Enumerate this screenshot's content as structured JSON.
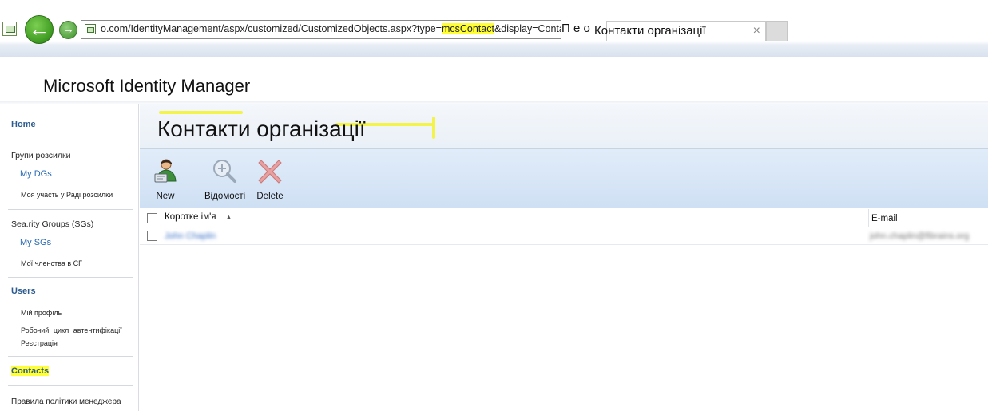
{
  "browser": {
    "url_pre": "o.com/IdentityManagement/aspx/customized/CustomizedObjects.aspx?type=",
    "url_highlight": "mcsContact",
    "url_post": "&display=Contact",
    "tab_prefix": "П е о",
    "tab_title": "Контакти організації",
    "tab_close_glyph": "×"
  },
  "header": {
    "app_title": "Microsoft Identity Manager"
  },
  "sidebar": {
    "home": "Home",
    "dist_group": "Групи розсилки",
    "my_dgs": "My DGs",
    "my_dg_membership": "Моя участь у Раді розсилки",
    "sec_group": "Sea.rity Groups (SGs)",
    "my_sgs": "My SGs",
    "my_sg_membership": "Мої членства в СГ",
    "users": "Users",
    "my_profile": "Мій профіль",
    "auth_workflow": "Робочий цикл автентифікації",
    "registration": "Реєстрація",
    "contacts": "Contacts",
    "policy_rules": "Правила політики менеджера"
  },
  "main": {
    "page_title": "Контакти організації",
    "toolbar": {
      "new_label": "New",
      "details_label": "Відомості",
      "delete_label": "Delete"
    },
    "grid": {
      "col_name": "Коротке ім'я",
      "col_email": "E-mail",
      "rows": [
        {
          "name": "John Chaplin",
          "email": "john.chaplin@fibrains.org"
        }
      ]
    }
  },
  "colors": {
    "highlight": "#ffff33",
    "nav_heading": "#2b5b8f",
    "nav_link": "#2769b4",
    "toolbar_bg": "#cfe0f4"
  },
  "icons": [
    "back-arrow-icon",
    "forward-arrow-icon",
    "new-user-icon",
    "magnifier-plus-icon",
    "delete-x-icon",
    "sort-ascending-icon"
  ]
}
